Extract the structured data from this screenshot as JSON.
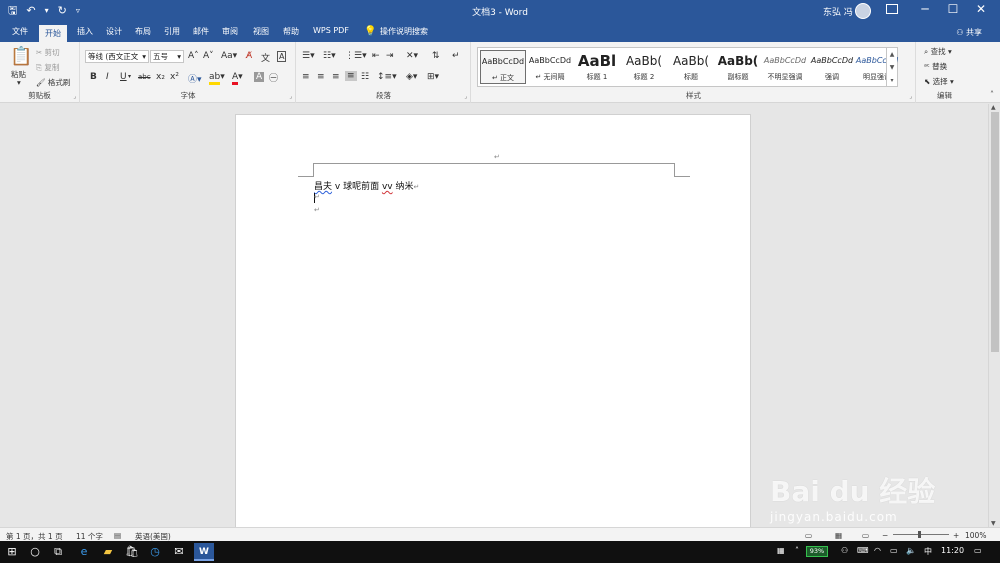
{
  "window": {
    "title": "文档3  -  Word",
    "user_name": "东弘 冯"
  },
  "tabs": [
    "文件",
    "开始",
    "插入",
    "设计",
    "布局",
    "引用",
    "邮件",
    "审阅",
    "视图",
    "帮助",
    "WPS PDF"
  ],
  "active_tab": "开始",
  "tell_me": "操作说明搜索",
  "share": "共享",
  "clipboard": {
    "paste": "粘贴",
    "cut": "剪切",
    "copy": "复制",
    "format_painter": "格式刷",
    "label": "剪贴板"
  },
  "font": {
    "font_name": "等线 (西文正文",
    "font_size": "五号",
    "label": "字体"
  },
  "paragraph": {
    "label": "段落"
  },
  "styles": {
    "label": "样式",
    "items": [
      {
        "sample": "AaBbCcDd",
        "name": "↵ 正文"
      },
      {
        "sample": "AaBbCcDd",
        "name": "↵ 无间隔"
      },
      {
        "sample": "AaBl",
        "name": "标题 1"
      },
      {
        "sample": "AaBb(",
        "name": "标题 2"
      },
      {
        "sample": "AaBb(",
        "name": "标题"
      },
      {
        "sample": "AaBb(",
        "name": "副标题"
      },
      {
        "sample": "AaBbCcDd",
        "name": "不明显强调"
      },
      {
        "sample": "AaBbCcDd",
        "name": "强调"
      },
      {
        "sample": "AaBbCcDd",
        "name": "明显强调"
      }
    ]
  },
  "editing": {
    "find": "查找",
    "replace": "替换",
    "select": "选择",
    "label": "编辑"
  },
  "document": {
    "header_mark": "↵",
    "line1_a": "昌夫",
    "line1_b": " v 球呢前面 ",
    "line1_c": "vv",
    "line1_d": " 纳米",
    "para_mark": "↵"
  },
  "status": {
    "page": "第 1 页，共 1 页",
    "words": "11 个字",
    "language": "英语(美国)",
    "zoom": "100%"
  },
  "taskbar": {
    "battery": "93%",
    "ime": "中",
    "time": "11:20"
  },
  "watermark": {
    "brand": "Bai du 经验",
    "url": "jingyan.baidu.com"
  },
  "colors": {
    "word_blue": "#2b579a",
    "ribbon_bg": "#f3f3f3"
  }
}
